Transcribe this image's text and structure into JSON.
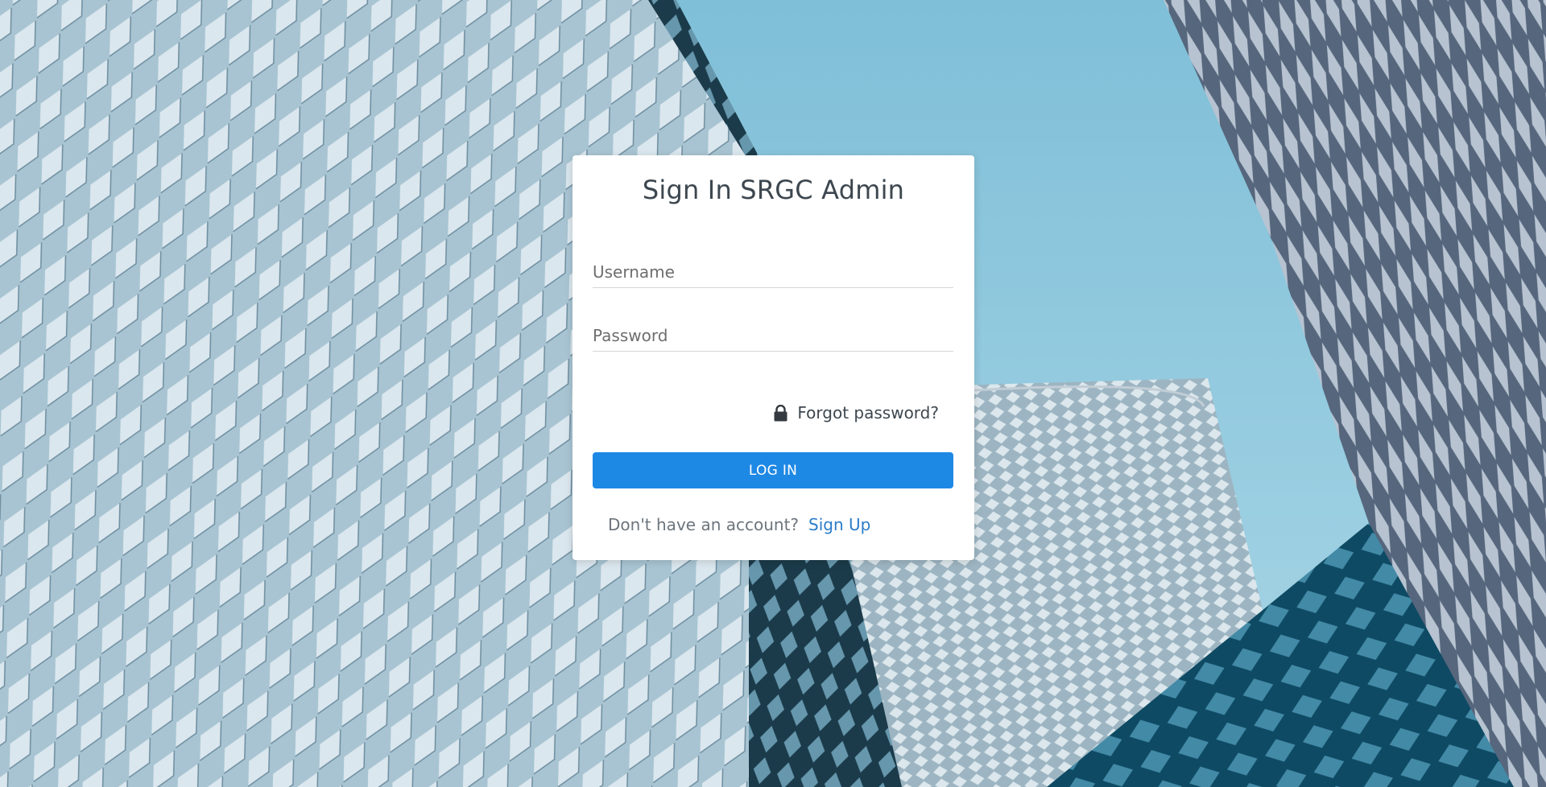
{
  "card": {
    "title": "Sign In SRGC Admin"
  },
  "form": {
    "username_placeholder": "Username",
    "username_value": "",
    "password_placeholder": "Password",
    "password_value": "",
    "forgot_label": "Forgot password?",
    "login_label": "LOG IN",
    "no_account_text": "Don't have an account?",
    "signup_label": "Sign Up"
  },
  "icons": {
    "forgot": "lock-icon"
  },
  "colors": {
    "primary_button": "#1e88e5",
    "link": "#2b7cc9",
    "title_text": "#3d474f",
    "card_background": "#ffffff"
  }
}
